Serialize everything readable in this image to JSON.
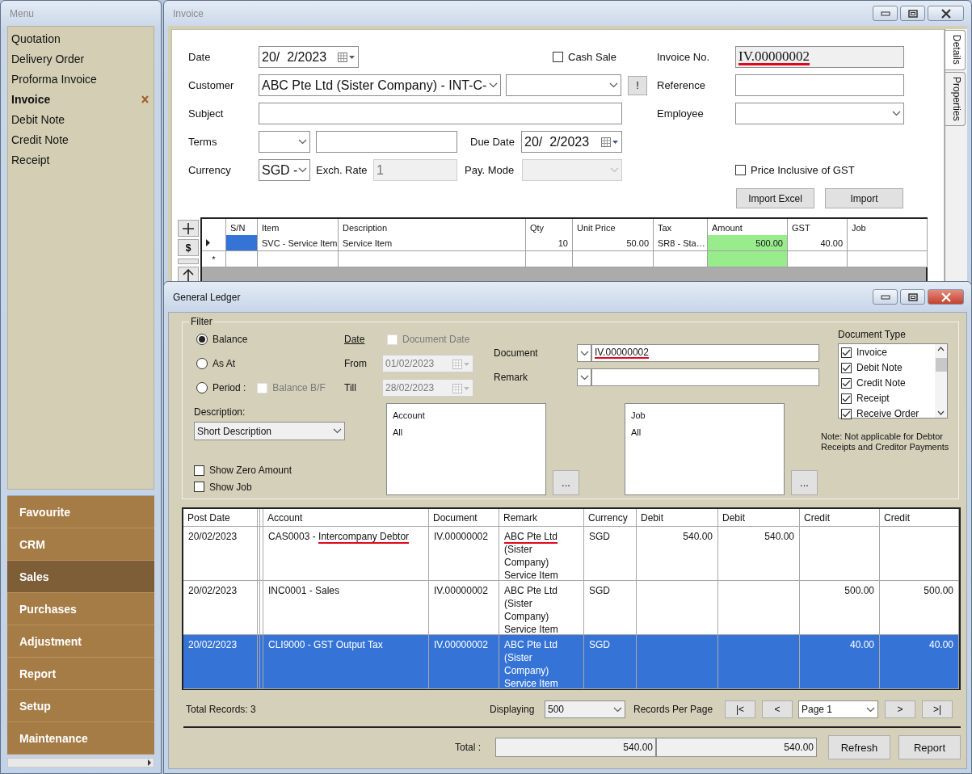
{
  "menu": {
    "title": "Menu",
    "items": [
      {
        "label": "Quotation",
        "selected": false,
        "closable": false
      },
      {
        "label": "Delivery Order",
        "selected": false,
        "closable": false
      },
      {
        "label": "Proforma Invoice",
        "selected": false,
        "closable": false
      },
      {
        "label": "Invoice",
        "selected": true,
        "closable": true
      },
      {
        "label": "Debit Note",
        "selected": false,
        "closable": false
      },
      {
        "label": "Credit Note",
        "selected": false,
        "closable": false
      },
      {
        "label": "Receipt",
        "selected": false,
        "closable": false
      }
    ],
    "groups": [
      {
        "label": "Favourite",
        "selected": false
      },
      {
        "label": "CRM",
        "selected": false
      },
      {
        "label": "Sales",
        "selected": true
      },
      {
        "label": "Purchases",
        "selected": false
      },
      {
        "label": "Adjustment",
        "selected": false
      },
      {
        "label": "Report",
        "selected": false
      },
      {
        "label": "Setup",
        "selected": false
      },
      {
        "label": "Maintenance",
        "selected": false
      }
    ]
  },
  "invoice": {
    "title": "Invoice",
    "date": {
      "label": "Date",
      "value": "20/  2/2023"
    },
    "cash_sale": {
      "label": "Cash Sale",
      "checked": false
    },
    "customer": {
      "label": "Customer",
      "value": "ABC Pte Ltd (Sister Company) - INT-C-"
    },
    "alert_button": "!",
    "subject": {
      "label": "Subject"
    },
    "terms": {
      "label": "Terms"
    },
    "due_date": {
      "label": "Due Date",
      "value": "20/  2/2023"
    },
    "currency": {
      "label": "Currency",
      "value": "SGD -"
    },
    "exch_rate": {
      "label": "Exch. Rate",
      "value": "1",
      "disabled": true
    },
    "pay_mode": {
      "label": "Pay. Mode",
      "disabled": true
    },
    "invoice_no": {
      "label": "Invoice No.",
      "value": "IV.00000002",
      "marked": true
    },
    "reference": {
      "label": "Reference"
    },
    "employee": {
      "label": "Employee"
    },
    "price_inclusive": {
      "label": "Price Inclusive of GST",
      "checked": false
    },
    "buttons": [
      "Import Excel",
      "Import"
    ],
    "side_tabs": [
      {
        "label": "Details",
        "selected": true
      },
      {
        "label": "Properties",
        "selected": false
      }
    ],
    "grid_tools": [
      {
        "kind": "add"
      },
      {
        "kind": "currency",
        "label": "$"
      },
      {
        "kind": "blank"
      },
      {
        "kind": "up"
      }
    ],
    "grid": {
      "columns": [
        {
          "label": "S/N",
          "highlight": false,
          "kind": "text"
        },
        {
          "label": "Item",
          "highlight": false,
          "kind": "text"
        },
        {
          "label": "Description",
          "highlight": false,
          "kind": "text"
        },
        {
          "label": "Qty",
          "highlight": false,
          "kind": "amount"
        },
        {
          "label": "Unit Price",
          "highlight": false,
          "kind": "amount"
        },
        {
          "label": "Tax",
          "highlight": false,
          "kind": "text"
        },
        {
          "label": "Amount",
          "highlight": true,
          "kind": "amount"
        },
        {
          "label": "GST",
          "highlight": false,
          "kind": "amount"
        },
        {
          "label": "Job",
          "highlight": false,
          "kind": "text"
        }
      ],
      "rows": [
        {
          "current": true,
          "cells": [
            {
              "focused": true
            },
            {
              "text": "SVC - Service Item",
              "focused": false
            },
            {
              "text": "Service Item",
              "focused": false
            },
            {
              "text": "10",
              "focused": false
            },
            {
              "text": "50.00",
              "focused": false
            },
            {
              "text": "SR8 - Sta…",
              "focused": false
            },
            {
              "text": "500.00",
              "focused": false
            },
            {
              "text": "40.00",
              "focused": false
            },
            {
              "focused": false
            }
          ]
        }
      ],
      "new_row_marker": "*"
    }
  },
  "ledger": {
    "title": "General Ledger",
    "filter": {
      "title": "Filter",
      "modes": [
        {
          "label": "Balance",
          "selected": true
        },
        {
          "label": "As At",
          "selected": false
        },
        {
          "label": "Period :",
          "selected": false
        }
      ],
      "balance_bf": {
        "label": "Balance B/F",
        "checked": false,
        "disabled": true
      },
      "date_heading": "Date",
      "document_date": {
        "label": "Document Date",
        "checked": false,
        "disabled": true
      },
      "from": {
        "label": "From",
        "value": "01/02/2023",
        "disabled": true
      },
      "till": {
        "label": "Till",
        "value": "28/02/2023",
        "disabled": true
      },
      "document": {
        "label": "Document",
        "value": "IV.00000002",
        "marked": true
      },
      "remark": {
        "label": "Remark"
      },
      "description": {
        "label": "Description:",
        "value": "Short Description"
      },
      "show_zero": {
        "label": "Show Zero Amount",
        "checked": false
      },
      "show_job": {
        "label": "Show Job",
        "checked": false
      },
      "account_list": {
        "heading": "Account",
        "items": [
          "All"
        ],
        "button": "..."
      },
      "job_list": {
        "heading": "Job",
        "items": [
          "All"
        ],
        "button": "..."
      },
      "document_type": {
        "label": "Document Type",
        "items": [
          {
            "label": "Invoice",
            "checked": true
          },
          {
            "label": "Debit Note",
            "checked": true
          },
          {
            "label": "Credit Note",
            "checked": true
          },
          {
            "label": "Receipt",
            "checked": true
          },
          {
            "label": "Receive Order",
            "checked": true
          }
        ]
      },
      "note": "Note: Not applicable for Debtor Receipts and Creditor Payments"
    },
    "table": {
      "columns": [
        {
          "label": "Post Date",
          "kind": "text"
        },
        {
          "label": "Account",
          "kind": "text"
        },
        {
          "label": "Document",
          "kind": "text"
        },
        {
          "label": "Remark",
          "kind": "text"
        },
        {
          "label": "Currency",
          "kind": "text"
        },
        {
          "label": "Debit",
          "kind": "amount"
        },
        {
          "label": "Debit",
          "kind": "amount"
        },
        {
          "label": "Credit",
          "kind": "amount"
        },
        {
          "label": "Credit",
          "kind": "amount"
        }
      ],
      "rows": [
        {
          "selected": false,
          "cells": [
            "20/02/2023",
            {
              "segments": [
                {
                  "text": "CAS0003 -",
                  "marked": false
                },
                {
                  "text": "Intercompany Debtor",
                  "marked": true
                }
              ]
            },
            "IV.00000002",
            {
              "lines": [
                {
                  "text": "ABC Pte Ltd",
                  "marked": true
                },
                {
                  "text": "(Sister",
                  "marked": false
                },
                {
                  "text": "Company)",
                  "marked": false
                },
                {
                  "text": "Service Item",
                  "marked": false
                }
              ]
            },
            "SGD",
            "540.00",
            "540.00",
            null,
            null
          ]
        },
        {
          "selected": false,
          "cells": [
            "20/02/2023",
            "INC0001 - Sales",
            "IV.00000002",
            {
              "lines": [
                {
                  "text": "ABC Pte Ltd",
                  "marked": false
                },
                {
                  "text": "(Sister",
                  "marked": false
                },
                {
                  "text": "Company)",
                  "marked": false
                },
                {
                  "text": "Service Item",
                  "marked": false
                }
              ]
            },
            "SGD",
            null,
            null,
            "500.00",
            "500.00"
          ]
        },
        {
          "selected": true,
          "cells": [
            "20/02/2023",
            "CLI9000 - GST Output Tax",
            "IV.00000002",
            {
              "lines": [
                {
                  "text": "ABC Pte Ltd",
                  "marked": false
                },
                {
                  "text": "(Sister",
                  "marked": false
                },
                {
                  "text": "Company)",
                  "marked": false
                },
                {
                  "text": "Service Item",
                  "marked": false
                }
              ]
            },
            "SGD",
            null,
            null,
            "40.00",
            "40.00"
          ]
        }
      ]
    },
    "total_records": "Total Records: 3",
    "displaying_label": "Displaying",
    "per_page": "500",
    "per_page_label": "Records Per Page",
    "pager": {
      "first": "|<",
      "prev": "<",
      "page": "Page 1",
      "next": ">",
      "last": ">|"
    },
    "total_label": "Total :",
    "totals": [
      "540.00",
      "540.00"
    ],
    "buttons": [
      "Refresh",
      "Report"
    ]
  }
}
